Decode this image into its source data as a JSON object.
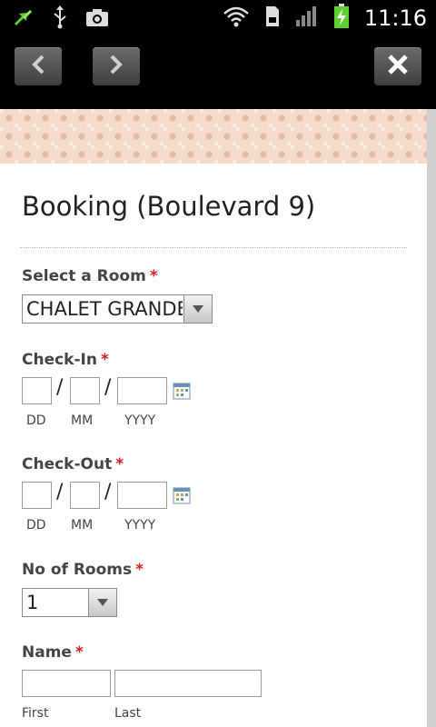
{
  "status_bar": {
    "time": "11:16",
    "icons_left": [
      "sync-arrows-icon",
      "usb-icon",
      "camera-icon"
    ],
    "icons_right": [
      "wifi-icon",
      "sd-card-icon",
      "signal-icon",
      "battery-charging-icon"
    ]
  },
  "toolbar": {
    "back_icon": "chevron-left-icon",
    "forward_icon": "chevron-right-icon",
    "close_label": "x"
  },
  "form": {
    "title": "Booking (Boulevard 9)",
    "required_mark": "*",
    "room": {
      "label": "Select a Room",
      "selected": "CHALET GRANDE"
    },
    "check_in": {
      "label": "Check-In",
      "sublabels": [
        "DD",
        "MM",
        "YYYY"
      ],
      "separator": "/"
    },
    "check_out": {
      "label": "Check-Out",
      "sublabels": [
        "DD",
        "MM",
        "YYYY"
      ],
      "separator": "/"
    },
    "rooms": {
      "label": "No of Rooms",
      "selected": "1"
    },
    "name": {
      "label": "Name",
      "sublabels": [
        "First",
        "Last"
      ]
    }
  },
  "colors": {
    "required": "#d31f1f",
    "banner": "#f3dccb"
  }
}
